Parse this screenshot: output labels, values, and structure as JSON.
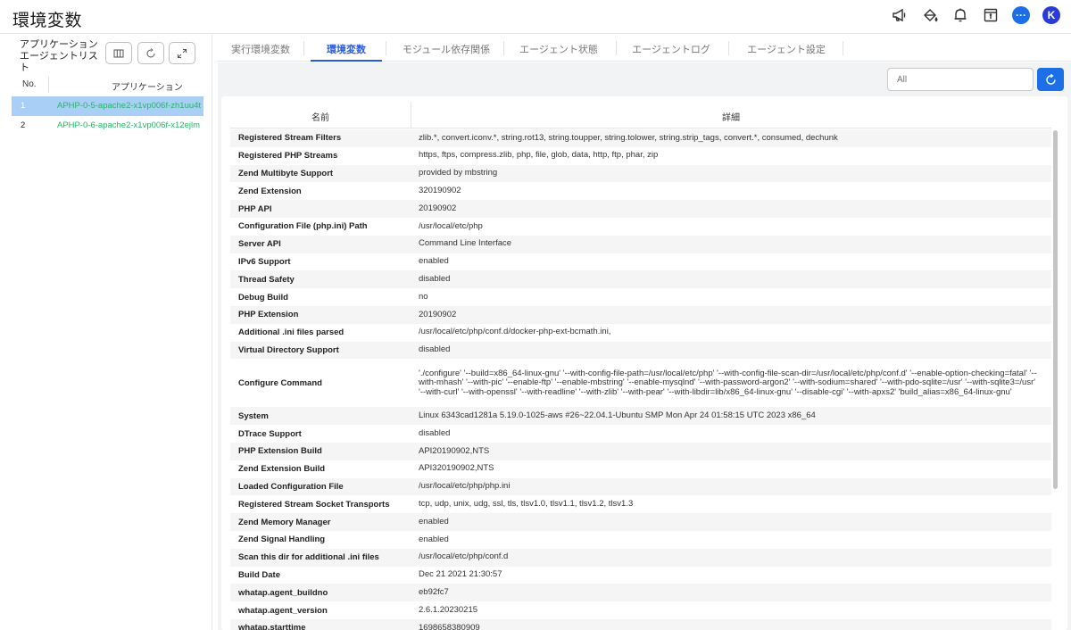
{
  "header": {
    "title": "環境変数",
    "icons": [
      "announcement-icon",
      "paint-bucket-icon",
      "bell-icon",
      "calendar-icon",
      "more-icon",
      "avatar"
    ],
    "avatar_letter": "K"
  },
  "left": {
    "title": "アプリケーションエージェントリスト",
    "col_no": "No.",
    "col_app": "アプリケーション",
    "items": [
      {
        "no": "1",
        "app": "APHP-0-5-apache2-x1vp006f-zh1uu4t"
      },
      {
        "no": "2",
        "app": "APHP-0-6-apache2-x1vp006f-x12ejlm"
      }
    ]
  },
  "tabs": [
    {
      "label": "実行環境変数"
    },
    {
      "label": "環境変数"
    },
    {
      "label": "モジュール依存関係"
    },
    {
      "label": "エージェント状態"
    },
    {
      "label": "エージェントログ"
    },
    {
      "label": "エージェント設定"
    }
  ],
  "search": {
    "placeholder": "All"
  },
  "table": {
    "col_name": "名前",
    "col_detail": "詳細",
    "rows": [
      {
        "k": "Registered Stream Filters",
        "v": "zlib.*, convert.iconv.*, string.rot13, string.toupper, string.tolower, string.strip_tags, convert.*, consumed, dechunk"
      },
      {
        "k": "Registered PHP Streams",
        "v": "https, ftps, compress.zlib, php, file, glob, data, http, ftp, phar, zip"
      },
      {
        "k": "Zend Multibyte Support",
        "v": "provided by mbstring"
      },
      {
        "k": "Zend Extension",
        "v": "320190902"
      },
      {
        "k": "PHP API",
        "v": "20190902"
      },
      {
        "k": "Configuration File (php.ini) Path",
        "v": "/usr/local/etc/php"
      },
      {
        "k": "Server API",
        "v": "Command Line Interface"
      },
      {
        "k": "IPv6 Support",
        "v": "enabled"
      },
      {
        "k": "Thread Safety",
        "v": "disabled"
      },
      {
        "k": "Debug Build",
        "v": "no"
      },
      {
        "k": "PHP Extension",
        "v": "20190902"
      },
      {
        "k": "Additional .ini files parsed",
        "v": "/usr/local/etc/php/conf.d/docker-php-ext-bcmath.ini,"
      },
      {
        "k": "Virtual Directory Support",
        "v": "disabled"
      },
      {
        "k": "Configure Command",
        "v": "'./configure' '--build=x86_64-linux-gnu' '--with-config-file-path=/usr/local/etc/php' '--with-config-file-scan-dir=/usr/local/etc/php/conf.d' '--enable-option-checking=fatal' '--with-mhash' '--with-pic' '--enable-ftp' '--enable-mbstring' '--enable-mysqlnd' '--with-password-argon2' '--with-sodium=shared' '--with-pdo-sqlite=/usr' '--with-sqlite3=/usr' '--with-curl' '--with-openssl' '--with-readline' '--with-zlib' '--with-pear' '--with-libdir=lib/x86_64-linux-gnu' '--disable-cgi' '--with-apxs2' 'build_alias=x86_64-linux-gnu'"
      },
      {
        "k": "System",
        "v": "Linux 6343cad1281a 5.19.0-1025-aws #26~22.04.1-Ubuntu SMP Mon Apr 24 01:58:15 UTC 2023 x86_64"
      },
      {
        "k": "DTrace Support",
        "v": "disabled"
      },
      {
        "k": "PHP Extension Build",
        "v": "API20190902,NTS"
      },
      {
        "k": "Zend Extension Build",
        "v": "API320190902,NTS"
      },
      {
        "k": "Loaded Configuration File",
        "v": "/usr/local/etc/php/php.ini"
      },
      {
        "k": "Registered Stream Socket Transports",
        "v": "tcp, udp, unix, udg, ssl, tls, tlsv1.0, tlsv1.1, tlsv1.2, tlsv1.3"
      },
      {
        "k": "Zend Memory Manager",
        "v": "enabled"
      },
      {
        "k": "Zend Signal Handling",
        "v": "enabled"
      },
      {
        "k": "Scan this dir for additional .ini files",
        "v": "/usr/local/etc/php/conf.d"
      },
      {
        "k": "Build Date",
        "v": "Dec 21 2021 21:30:57"
      },
      {
        "k": "whatap.agent_buildno",
        "v": "eb92fc7"
      },
      {
        "k": "whatap.agent_version",
        "v": "2.6.1.20230215"
      },
      {
        "k": "whatap.starttime",
        "v": "1698658380909"
      }
    ]
  },
  "colors": {
    "accent": "#2a5bd7",
    "button": "#1d6fe8",
    "app_green": "#28b46a",
    "selected_row": "#a9cff6"
  }
}
